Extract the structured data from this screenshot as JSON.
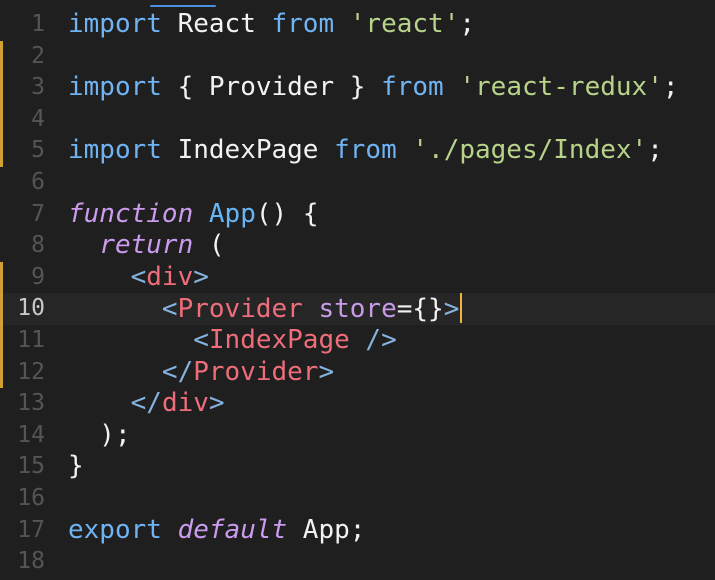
{
  "editor": {
    "lines": [
      {
        "n": "1",
        "segments": [
          {
            "t": "import",
            "c": "kw"
          },
          {
            "t": " React ",
            "c": "pl"
          },
          {
            "t": "from",
            "c": "kw"
          },
          {
            "t": " ",
            "c": "pl"
          },
          {
            "t": "'react'",
            "c": "str"
          },
          {
            "t": ";",
            "c": "pl"
          }
        ]
      },
      {
        "n": "2",
        "segments": []
      },
      {
        "n": "3",
        "segments": [
          {
            "t": "import",
            "c": "kw"
          },
          {
            "t": " { Provider } ",
            "c": "pl"
          },
          {
            "t": "from",
            "c": "kw"
          },
          {
            "t": " ",
            "c": "pl"
          },
          {
            "t": "'react-redux'",
            "c": "str"
          },
          {
            "t": ";",
            "c": "pl"
          }
        ]
      },
      {
        "n": "4",
        "segments": []
      },
      {
        "n": "5",
        "segments": [
          {
            "t": "import",
            "c": "kw"
          },
          {
            "t": " IndexPage ",
            "c": "pl"
          },
          {
            "t": "from",
            "c": "kw"
          },
          {
            "t": " ",
            "c": "pl"
          },
          {
            "t": "'./pages/Index'",
            "c": "str"
          },
          {
            "t": ";",
            "c": "pl"
          }
        ]
      },
      {
        "n": "6",
        "segments": []
      },
      {
        "n": "7",
        "segments": [
          {
            "t": "function",
            "c": "kwi"
          },
          {
            "t": " ",
            "c": "pl"
          },
          {
            "t": "App",
            "c": "fn"
          },
          {
            "t": "() {",
            "c": "pl"
          }
        ]
      },
      {
        "n": "8",
        "segments": [
          {
            "t": "  ",
            "c": "pl"
          },
          {
            "t": "return",
            "c": "kwi"
          },
          {
            "t": " (",
            "c": "pl"
          }
        ]
      },
      {
        "n": "9",
        "segments": [
          {
            "t": "    ",
            "c": "pl"
          },
          {
            "t": "<",
            "c": "tagb"
          },
          {
            "t": "div",
            "c": "tag"
          },
          {
            "t": ">",
            "c": "tagb"
          }
        ]
      },
      {
        "n": "10",
        "segments": [
          {
            "t": "      ",
            "c": "pl"
          },
          {
            "t": "<",
            "c": "tagb"
          },
          {
            "t": "Provider",
            "c": "tag"
          },
          {
            "t": " ",
            "c": "pl"
          },
          {
            "t": "store",
            "c": "attr"
          },
          {
            "t": "=",
            "c": "pl"
          },
          {
            "t": "{}",
            "c": "pl"
          },
          {
            "t": ">",
            "c": "tagb"
          }
        ]
      },
      {
        "n": "11",
        "segments": [
          {
            "t": "        ",
            "c": "pl"
          },
          {
            "t": "<",
            "c": "tagb"
          },
          {
            "t": "IndexPage",
            "c": "tag"
          },
          {
            "t": " />",
            "c": "tagb"
          }
        ]
      },
      {
        "n": "12",
        "segments": [
          {
            "t": "      ",
            "c": "pl"
          },
          {
            "t": "</",
            "c": "tagb"
          },
          {
            "t": "Provider",
            "c": "tag"
          },
          {
            "t": ">",
            "c": "tagb"
          }
        ]
      },
      {
        "n": "13",
        "segments": [
          {
            "t": "    ",
            "c": "pl"
          },
          {
            "t": "</",
            "c": "tagb"
          },
          {
            "t": "div",
            "c": "tag"
          },
          {
            "t": ">",
            "c": "tagb"
          }
        ]
      },
      {
        "n": "14",
        "segments": [
          {
            "t": "  );",
            "c": "pl"
          }
        ]
      },
      {
        "n": "15",
        "segments": [
          {
            "t": "}",
            "c": "pl"
          }
        ]
      },
      {
        "n": "16",
        "segments": []
      },
      {
        "n": "17",
        "segments": [
          {
            "t": "export",
            "c": "kw"
          },
          {
            "t": " ",
            "c": "pl"
          },
          {
            "t": "default",
            "c": "kwi"
          },
          {
            "t": " App;",
            "c": "pl"
          }
        ]
      },
      {
        "n": "18",
        "segments": []
      }
    ],
    "active_line": 10,
    "modified_lines": [
      2,
      3,
      4,
      5,
      9,
      10,
      11,
      12
    ],
    "colors": {
      "keyword": "#6fb3f3",
      "italic_keyword": "#cb9bf0",
      "string": "#b7d38a",
      "tag": "#ef6d7a",
      "bracket": "#86b3de",
      "cursor": "#f0b53a",
      "modified_marker": "#d1a032"
    }
  }
}
